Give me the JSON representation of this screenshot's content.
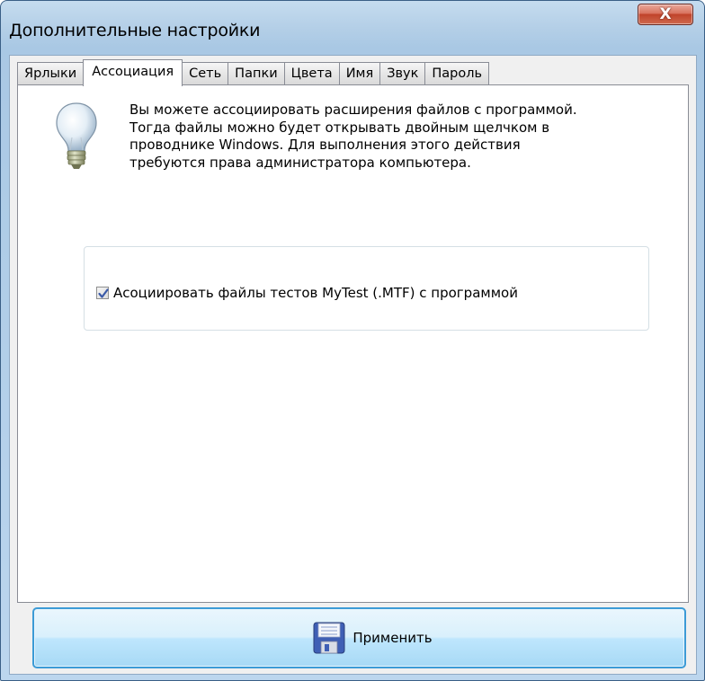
{
  "window": {
    "title": "Дополнительные настройки",
    "close_label": "X"
  },
  "tabs": [
    {
      "label": "Ярлыки",
      "active": false
    },
    {
      "label": "Ассоциация",
      "active": true
    },
    {
      "label": "Сеть",
      "active": false
    },
    {
      "label": "Папки",
      "active": false
    },
    {
      "label": "Цвета",
      "active": false
    },
    {
      "label": "Имя",
      "active": false
    },
    {
      "label": "Звук",
      "active": false
    },
    {
      "label": "Пароль",
      "active": false
    }
  ],
  "association": {
    "info_lines": [
      "Вы можете ассоциировать расширения файлов с программой.",
      "Тогда файлы можно будет открывать двойным щелчком в",
      "проводнике Windows. Для выполнения этого действия",
      "требуются права администратора компьютера."
    ],
    "info_icon": "lightbulb-icon",
    "checkbox_label": "Асоциировать файлы тестов  MyTest (.MTF) с программой",
    "checkbox_checked": true
  },
  "apply_button": {
    "label": "Применить",
    "icon": "floppy-disk-icon"
  },
  "colors": {
    "accent": "#3c9bd6",
    "close": "#c0432a"
  }
}
